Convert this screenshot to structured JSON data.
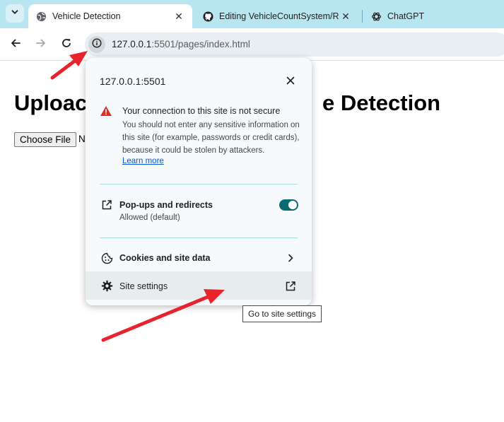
{
  "tabs": [
    {
      "title": "Vehicle Detection",
      "icon": "globe-icon",
      "active": true
    },
    {
      "title": "Editing VehicleCountSystem/README.md",
      "icon": "github-icon",
      "active": false
    },
    {
      "title": "ChatGPT",
      "icon": "chatgpt-icon",
      "active": false
    }
  ],
  "address_bar": {
    "host": "127.0.0.1",
    "port_path": ":5501/pages/index.html"
  },
  "page": {
    "heading_left": "Uploac",
    "heading_right": "e Detection",
    "file_button": "Choose File",
    "file_status": "N"
  },
  "site_info_popup": {
    "title": "127.0.0.1:5501",
    "security_title": "Your connection to this site is not secure",
    "security_desc": "You should not enter any sensitive information on this site (for example, passwords or credit cards), because it could be stolen by attackers.",
    "learn_more": "Learn more",
    "popups_label": "Pop-ups and redirects",
    "popups_status": "Allowed (default)",
    "popups_enabled": true,
    "cookies_label": "Cookies and site data",
    "site_settings_label": "Site settings"
  },
  "tooltip": "Go to site settings",
  "colors": {
    "tab_strip": "#b8e6f0",
    "toggle_on": "#0b6a70",
    "warning": "#d93025",
    "link": "#0b57d0",
    "annotation_arrow": "#e8232b"
  }
}
